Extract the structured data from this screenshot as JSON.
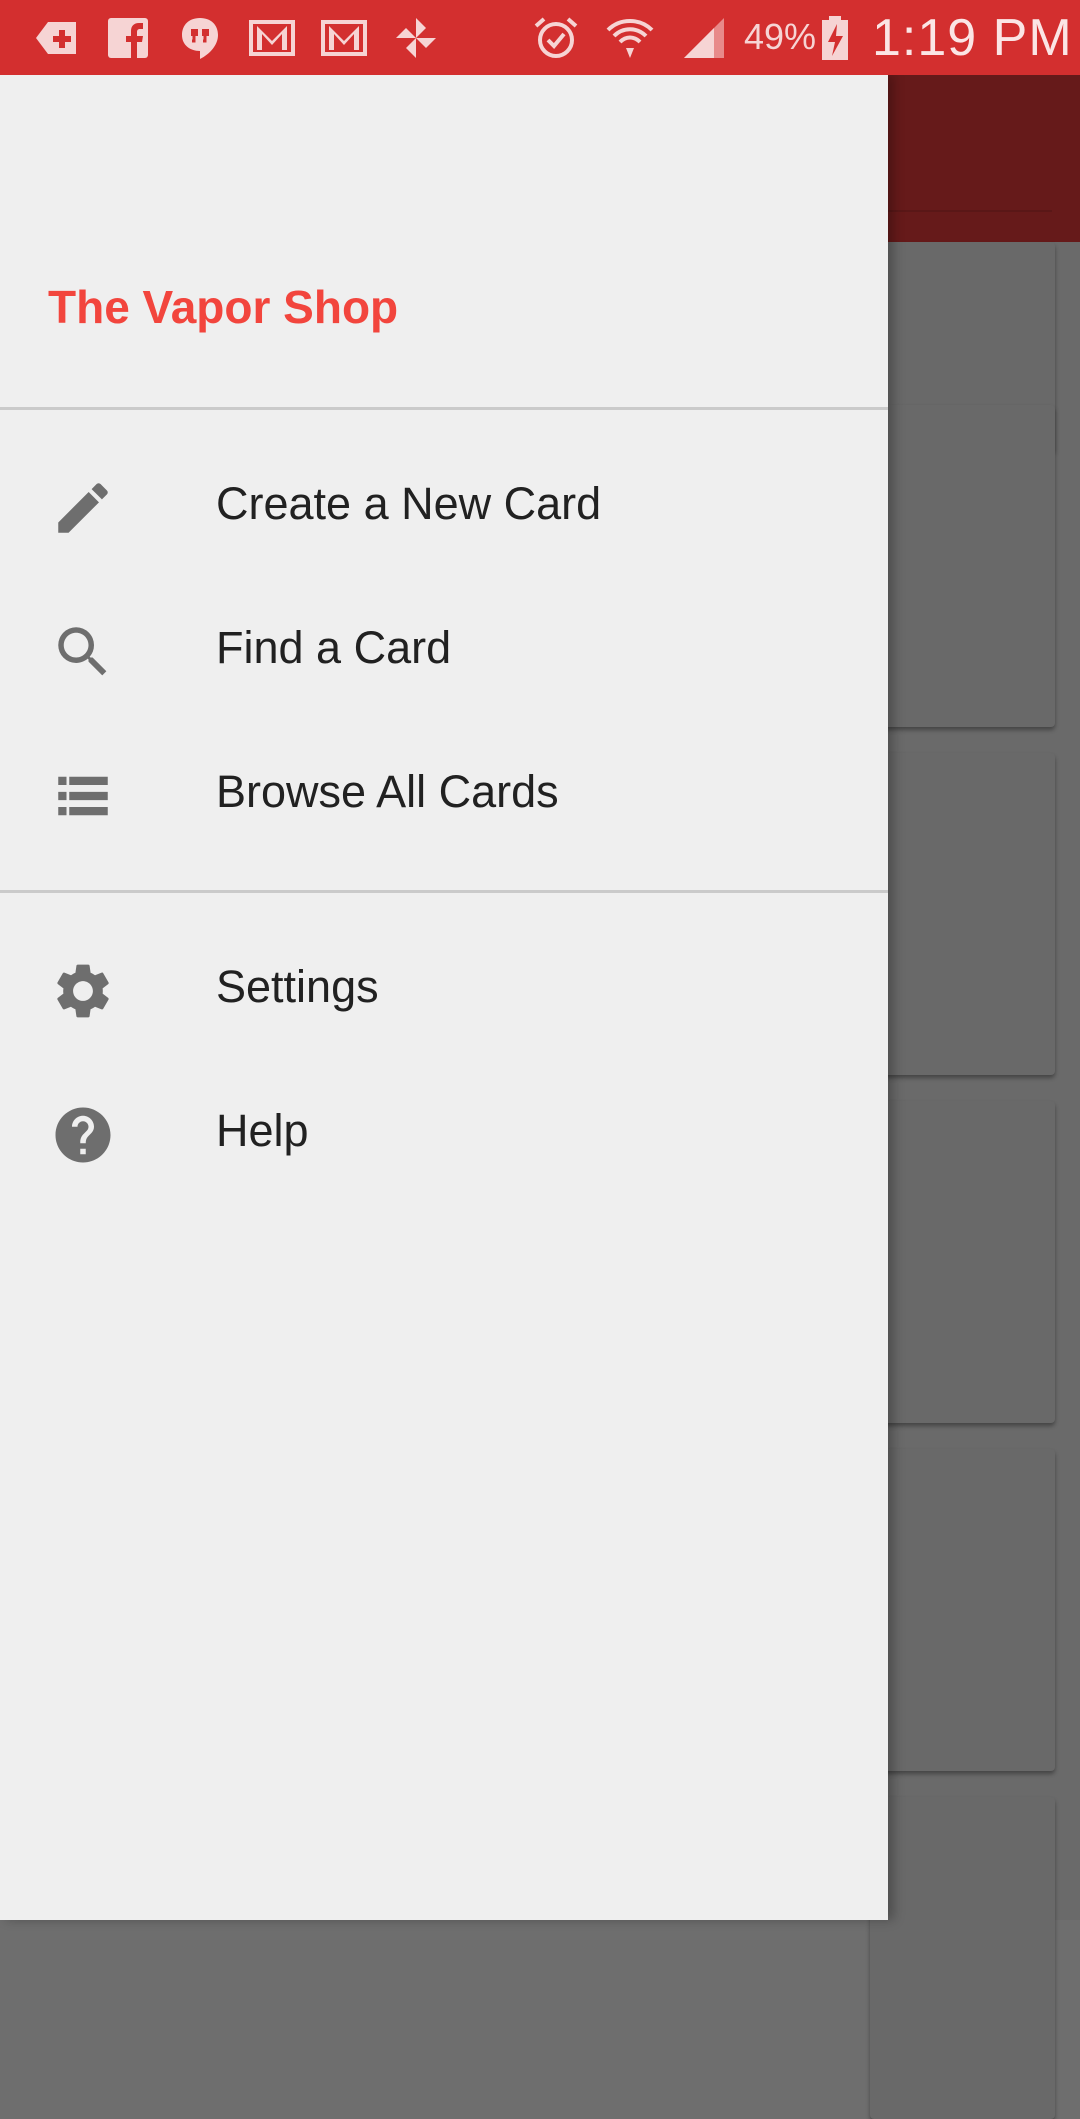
{
  "status_bar": {
    "battery_percent": "49%",
    "time": "1:19 PM",
    "notification_icons": [
      "add-badge-icon",
      "facebook-icon",
      "hangouts-icon",
      "gmail-icon",
      "gmail-icon",
      "pinwheel-icon"
    ],
    "system_icons": [
      "alarm-icon",
      "wifi-icon",
      "signal-icon",
      "battery-charging-icon"
    ]
  },
  "drawer": {
    "title": "The Vapor Shop",
    "title_color": "#f2453d",
    "primary_items": [
      {
        "label": "Create a New Card",
        "icon": "pencil-icon"
      },
      {
        "label": "Find a Card",
        "icon": "search-icon"
      },
      {
        "label": "Browse All Cards",
        "icon": "list-icon"
      }
    ],
    "secondary_items": [
      {
        "label": "Settings",
        "icon": "gear-icon"
      },
      {
        "label": "Help",
        "icon": "help-icon"
      }
    ]
  },
  "colors": {
    "status_bar": "#d32f2f",
    "toolbar_dimmed": "#661a1a",
    "drawer_background": "#efefef",
    "icon_gray": "#6e6e6e"
  }
}
